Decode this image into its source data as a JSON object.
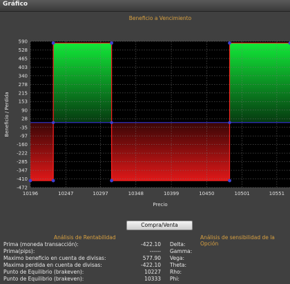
{
  "window": {
    "title": "Gráfico"
  },
  "chart_data": {
    "type": "area",
    "title": "Beneficio a Vencimiento",
    "xlabel": "Precio",
    "ylabel": "Beneficio / Perdida",
    "x_ticks": [
      10196,
      10247,
      10297,
      10348,
      10399,
      10450,
      10501,
      10551
    ],
    "y_ticks": [
      590,
      528,
      465,
      403,
      340,
      278,
      215,
      153,
      90,
      28,
      -35,
      -97,
      -160,
      -222,
      -285,
      -347,
      -410,
      -472
    ],
    "xlim": [
      10196,
      10570
    ],
    "ylim": [
      -472,
      590
    ],
    "grid": true,
    "series": [
      {
        "x": [
          10196,
          10229,
          10229,
          10313,
          10313,
          10483,
          10483,
          10570
        ],
        "y": [
          -422.1,
          -422.1,
          577.9,
          577.9,
          -422.1,
          -422.1,
          577.9,
          577.9
        ]
      }
    ],
    "breakeven_y": 0,
    "colors": {
      "profit": "#10d030",
      "loss": "#d01818",
      "line": "#ff2020",
      "marker": "#4040d0",
      "axis": "#3030c0"
    }
  },
  "buttons": {
    "buy_sell": "Compra/Venta"
  },
  "profitability": {
    "title": "Análisis de Rentabilidad",
    "rows": [
      {
        "label": "Prima (moneda transacción):",
        "value": "-422.10"
      },
      {
        "label": "Prima(pips):",
        "value": "------"
      },
      {
        "label": "Maximo beneficio en cuenta de divisas:",
        "value": "577.90"
      },
      {
        "label": "Maxima perdida en cuenta de divisas:",
        "value": "-422.10"
      },
      {
        "label": "Punto de Equilibrio (brakeven):",
        "value": "10227"
      },
      {
        "label": "Punto de Equilibrio (brakeven):",
        "value": "10333"
      }
    ]
  },
  "sensitivity": {
    "title": "Análisis de sensibilidad de la Opción",
    "greeks": [
      "Delta:",
      "Gamma:",
      "Vega:",
      "Theta:",
      "Rho:",
      "Phi:"
    ]
  }
}
